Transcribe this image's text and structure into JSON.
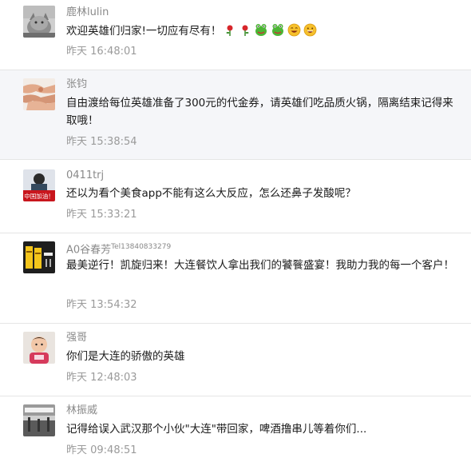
{
  "comments": [
    {
      "user": "鹿林lulin",
      "text": "欢迎英雄们归家!一切应有尽有！",
      "emojis": [
        "rose-icon",
        "rose-icon",
        "frog-icon",
        "frog-icon",
        "grin-face-icon",
        "laugh-face-icon"
      ],
      "time": "昨天 16:48:01"
    },
    {
      "user": "张钧",
      "text": "自由渡给每位英雄准备了300元的代金券，请英雄们吃品质火锅，隔离结束记得来取哦！",
      "time": "昨天 15:38:54"
    },
    {
      "user": "0411trj",
      "text": "还以为看个美食app不能有这么大反应，怎么还鼻子发酸呢？",
      "time": "昨天 15:33:21",
      "avatar_text": "中国加油！"
    },
    {
      "user": "A0谷春芳",
      "user_tag": "Tel13840833279",
      "text": "最美逆行！凯旋归来！大连餐饮人拿出我们的饕餮盛宴！我助力我的每一个客户！",
      "time": "昨天 13:54:32"
    },
    {
      "user": "强哥",
      "text": "你们是大连的骄傲的英雄",
      "time": "昨天 12:48:03"
    },
    {
      "user": "林振威",
      "text": "记得给误入武汉那个小伙\"大连\"带回家，啤酒撸串儿等着你们...",
      "time": "昨天 09:48:51"
    }
  ],
  "colors": {
    "highlight_bg": "#f5f6f9",
    "username": "#8a8a8a",
    "timestamp": "#9a9a9a",
    "divider": "#e5e5e5"
  }
}
